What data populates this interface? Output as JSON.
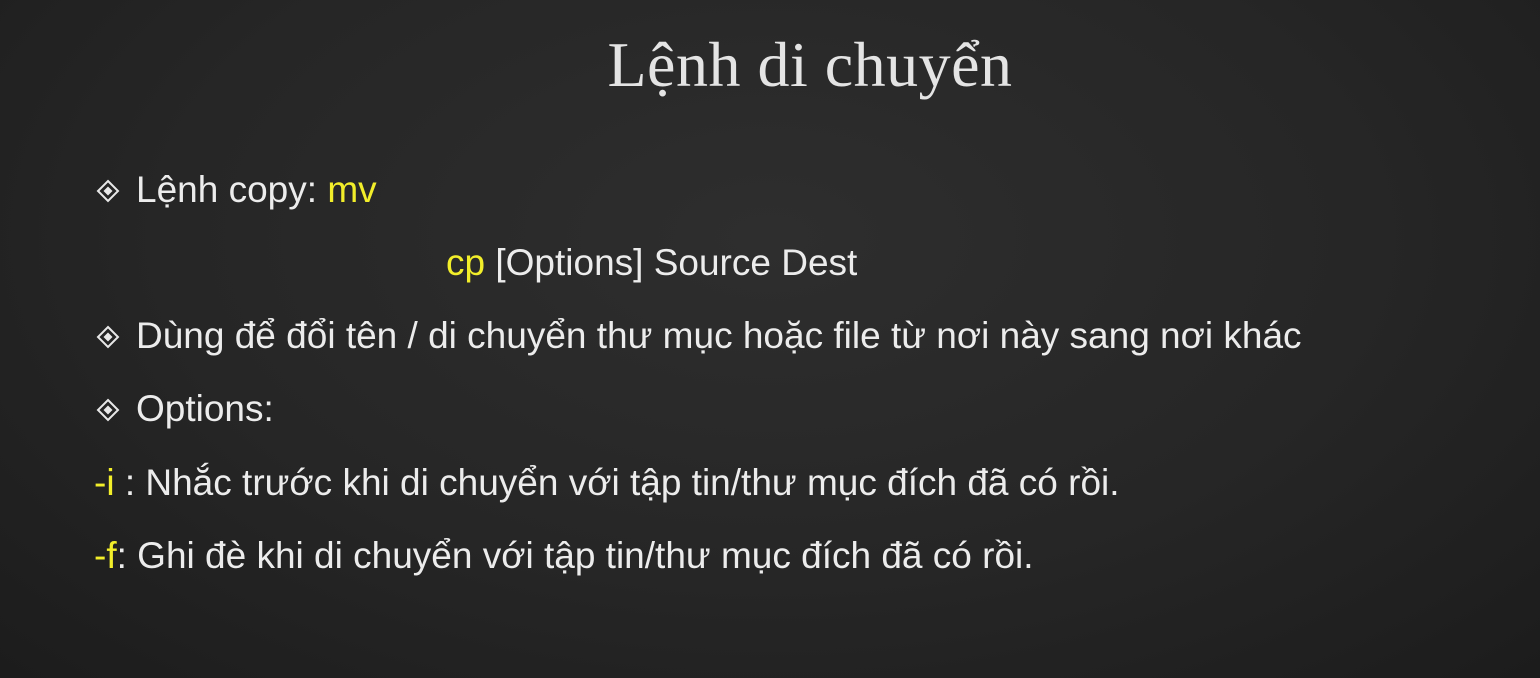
{
  "slide": {
    "title": "Lệnh di chuyển",
    "colors": {
      "background": "#262626",
      "text": "#ececec",
      "highlight": "#f2ee2a"
    },
    "bullet_icon": "diamond-bullet-icon",
    "line1": {
      "label": "Lệnh copy: ",
      "command": "mv"
    },
    "line2": {
      "command": "cp",
      "rest": " [Options] Source Dest"
    },
    "line3": {
      "text": "Dùng để đổi tên / di chuyển thư mục hoặc file từ nơi này sang nơi khác"
    },
    "line4": {
      "text": "Options:"
    },
    "option_i": {
      "flag": "-i",
      "description": " : Nhắc trước khi di chuyển với tập tin/thư mục đích đã có rồi."
    },
    "option_f": {
      "flag": "-f",
      "description": ": Ghi đè khi di chuyển với tập tin/thư mục đích đã có rồi."
    }
  }
}
